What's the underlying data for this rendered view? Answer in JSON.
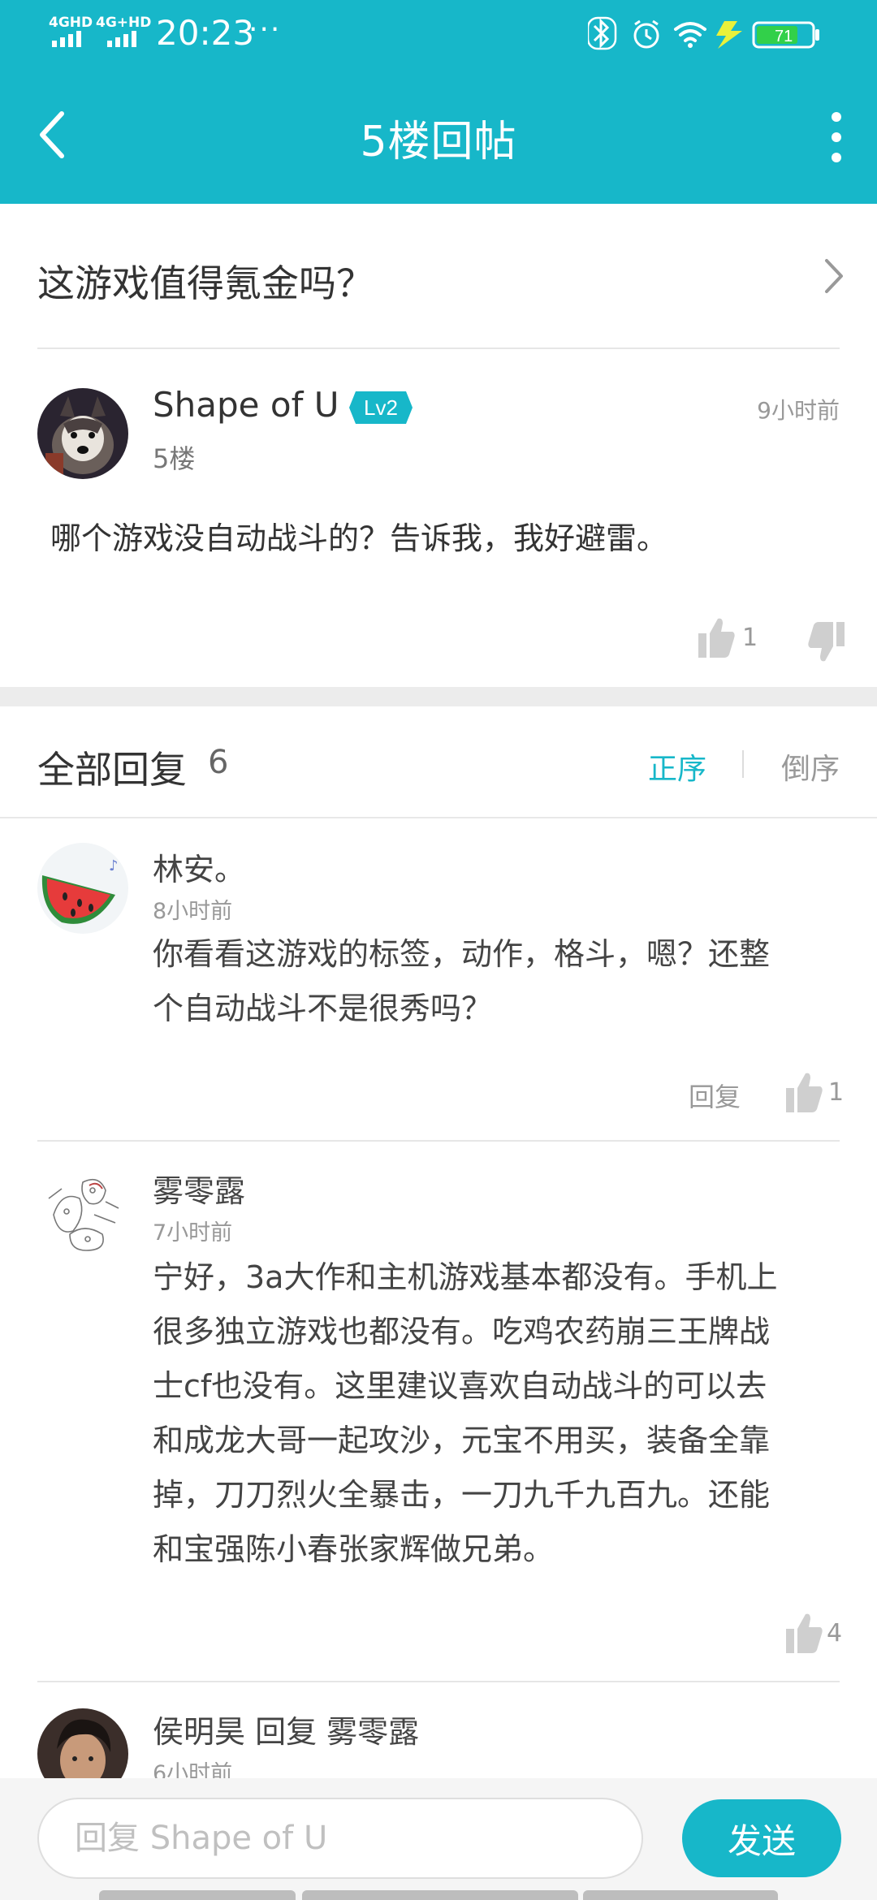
{
  "status_bar": {
    "sim1": "4GHD",
    "sim2": "4G+HD",
    "time": "20:23",
    "more": "···",
    "battery": "71"
  },
  "appbar": {
    "title": "5楼回帖"
  },
  "thread": {
    "title": "这游戏值得氪金吗？"
  },
  "post": {
    "author": "Shape of U",
    "level": "Lv2",
    "time": "9小时前",
    "floor": "5楼",
    "body": "哪个游戏没自动战斗的？告诉我，我好避雷。",
    "likes": "1"
  },
  "replies_header": {
    "title": "全部回复",
    "count": "6",
    "sort_asc": "正序",
    "sort_desc": "倒序"
  },
  "replies": [
    {
      "name": "林安。",
      "time": "8小时前",
      "body_lines": [
        "你看看这游戏的标签，动作，格斗，嗯？还整",
        "个自动战斗不是很秀吗？"
      ],
      "reply_label": "回复",
      "likes": "1"
    },
    {
      "name": "雾零露",
      "time": "7小时前",
      "body_lines": [
        "宁好，3a大作和主机游戏基本都没有。手机上",
        "很多独立游戏也都没有。吃鸡农药崩三王牌战",
        "士cf也没有。这里建议喜欢自动战斗的可以去",
        "和成龙大哥一起攻沙，元宝不用买，装备全靠",
        "掉，刀刀烈火全暴击，一刀九千九百九。还能",
        "和宝强陈小春张家辉做兄弟。"
      ],
      "likes": "4"
    },
    {
      "name": "侯明昊 回复 雾零露",
      "time": "6小时前"
    }
  ],
  "bottom_bar": {
    "placeholder": "回复 Shape of U",
    "send_label": "发送"
  },
  "colors": {
    "accent": "#17b7c9",
    "divider": "#e6e6e6",
    "muted_text": "#999999"
  }
}
